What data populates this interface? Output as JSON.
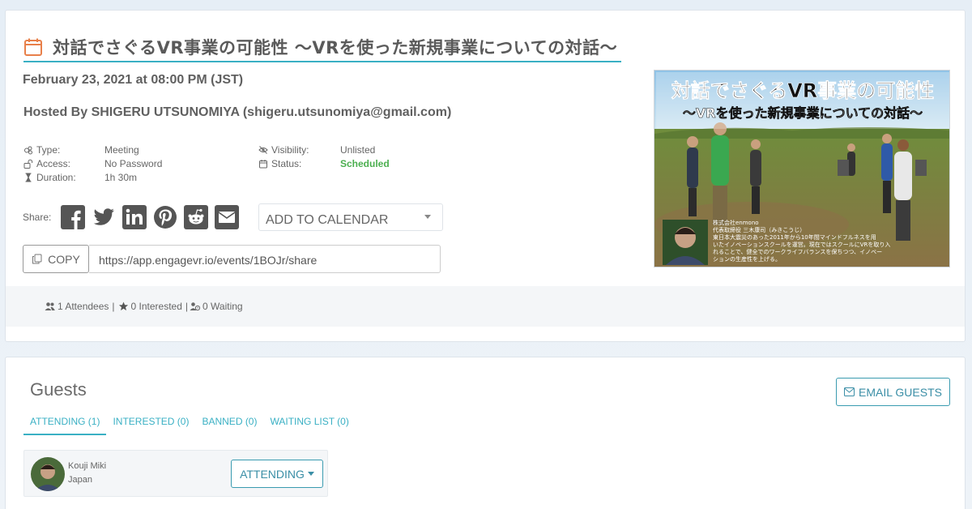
{
  "event": {
    "title": "対話でさぐるVR事業の可能性 〜VRを使った新規事業についての対話〜",
    "date": "February 23, 2021 at 08:00 PM (JST)",
    "host": "Hosted By SHIGERU UTSUNOMIYA (shigeru.utsunomiya@gmail.com)",
    "meta_left": [
      {
        "label": "Type:",
        "value": "Meeting",
        "icon": "meeting-icon"
      },
      {
        "label": "Access:",
        "value": "No Password",
        "icon": "unlock-icon"
      },
      {
        "label": "Duration:",
        "value": "1h 30m",
        "icon": "hourglass-icon"
      }
    ],
    "meta_right": [
      {
        "label": "Visibility:",
        "value": "Unlisted",
        "icon": "eye-slash-icon"
      },
      {
        "label": "Status:",
        "value": "Scheduled",
        "icon": "calendar-icon"
      }
    ],
    "share_label": "Share:",
    "share_icons": [
      "facebook-icon",
      "twitter-icon",
      "linkedin-icon",
      "pinterest-icon",
      "reddit-icon",
      "email-icon"
    ],
    "add_to_calendar": "ADD TO CALENDAR",
    "copy_label": "COPY",
    "share_url": "https://app.engagevr.io/events/1BOJr/share",
    "image": {
      "headline": "対話でさぐるVR事業の可能性",
      "subheadline": "〜VRを使った新規事業についての対話〜",
      "bio_lines": [
        "株式会社enmono",
        "代表取締役 三木康司（みきこうじ）",
        "東日本大震災のあった2011年から10年間マインドフルネスを用",
        "いたイノベーションスクールを運営。現在ではスクールにVRを取り入",
        "れることで、健全でのワークライフバランスを保ちつつ、イノベー",
        "ションの生産性を上げる。"
      ]
    },
    "stats": {
      "attendees": "1 Attendees",
      "interested": "0 Interested",
      "waiting": "0 Waiting",
      "separator": "|"
    }
  },
  "guests": {
    "title": "Guests",
    "email_button": "EMAIL GUESTS",
    "tabs": [
      {
        "label": "ATTENDING (1)",
        "active": true
      },
      {
        "label": "INTERESTED (0)",
        "active": false
      },
      {
        "label": "BANNED (0)",
        "active": false
      },
      {
        "label": "WAITING LIST (0)",
        "active": false
      }
    ],
    "list": [
      {
        "name": "Kouji Miki",
        "country": "Japan",
        "status": "ATTENDING"
      }
    ]
  },
  "colors": {
    "accent": "#3ab0c4",
    "status_scheduled": "#4caf50",
    "title_icon": "#e8804a"
  }
}
